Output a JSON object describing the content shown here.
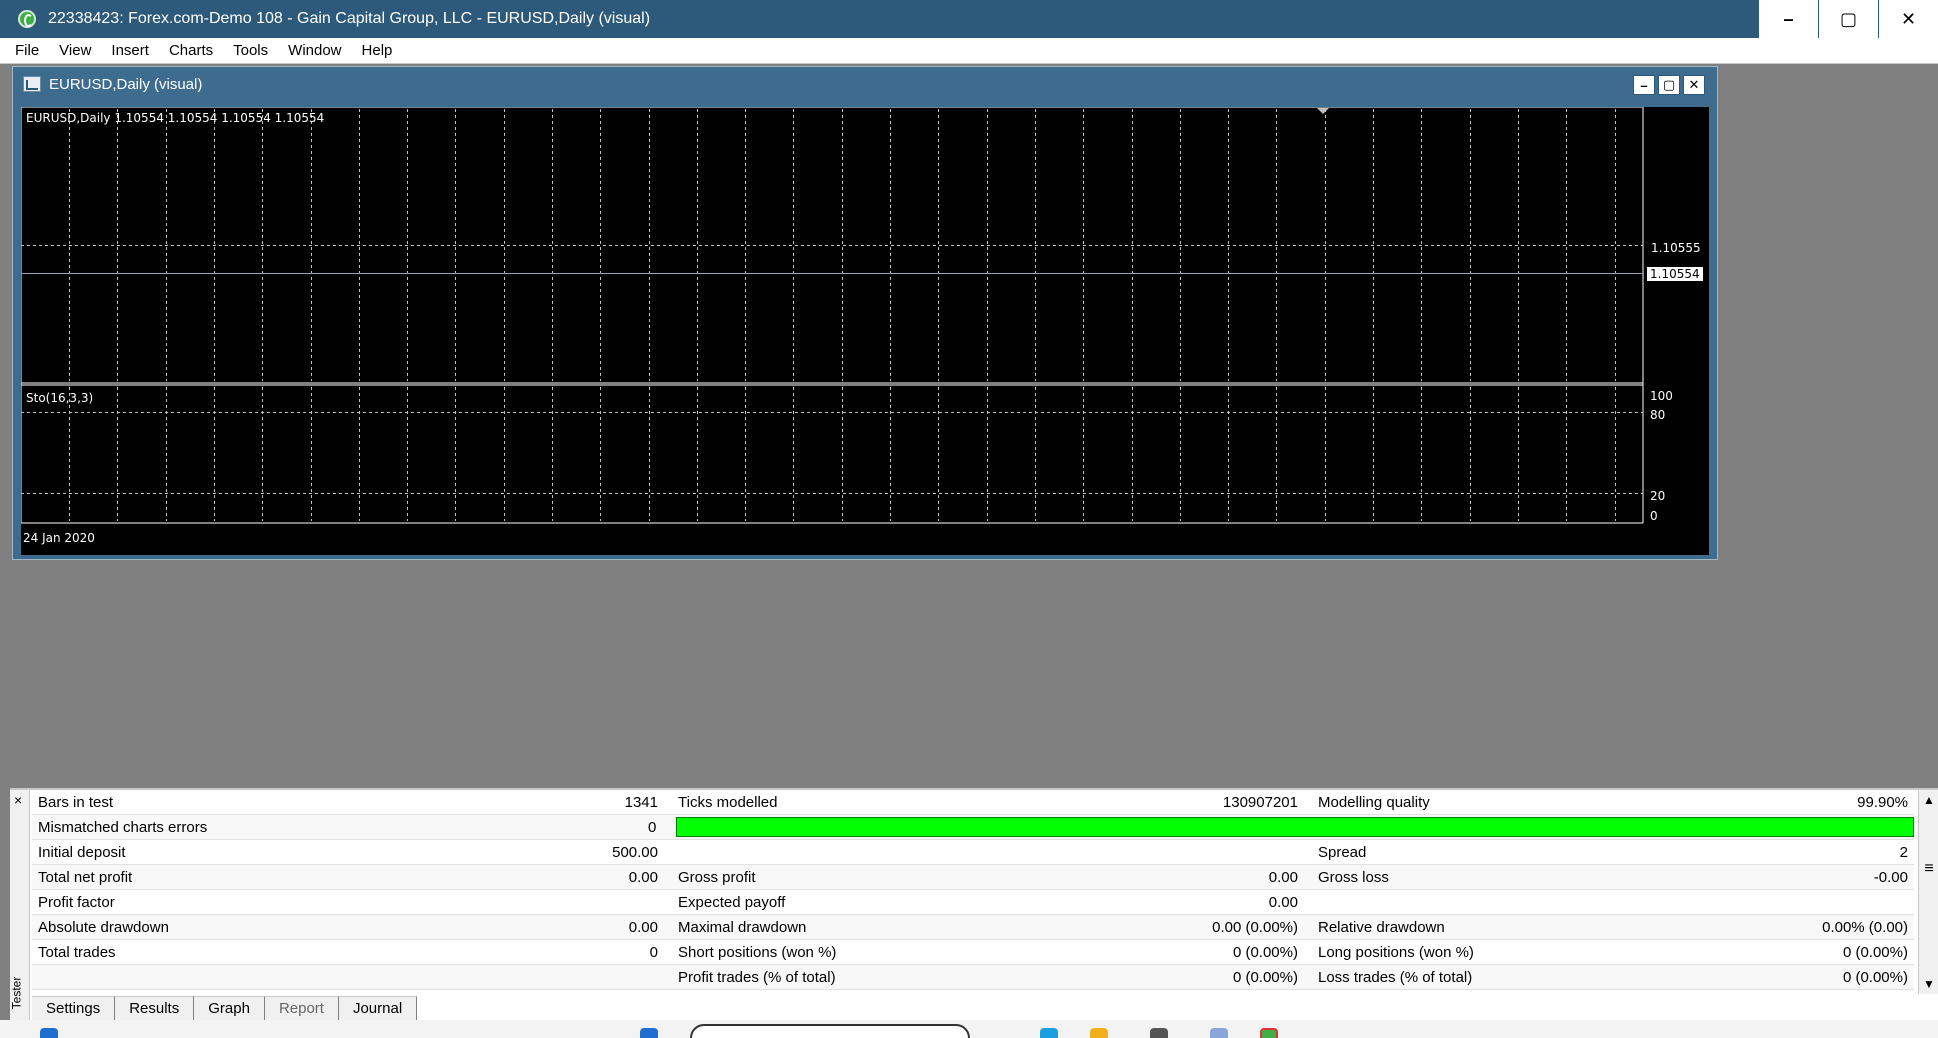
{
  "window": {
    "title": "22338423: Forex.com-Demo 108 - Gain Capital Group, LLC - EURUSD,Daily (visual)",
    "minimize": "–",
    "maximize": "▢",
    "close": "✕"
  },
  "menu": [
    "File",
    "View",
    "Insert",
    "Charts",
    "Tools",
    "Window",
    "Help"
  ],
  "chart": {
    "window_title": "EURUSD,Daily (visual)",
    "header": "EURUSD,Daily  1.10554 1.10554 1.10554 1.10554",
    "price_high": "1.10555",
    "price_current": "1.10554",
    "indicator_label": "Sto(16,3,3)",
    "sto_levels": [
      "100",
      "80",
      "20",
      "0"
    ],
    "date_label": "24 Jan 2020"
  },
  "tester": {
    "side_label": "Tester",
    "close": "×",
    "modelling_quality_fraction": 0.999,
    "rows": [
      {
        "l1": "Bars in test",
        "v1": "1341",
        "l2": "Ticks modelled",
        "v2": "130907201",
        "l3": "Modelling quality",
        "v3": "99.90%"
      },
      {
        "l1": "Mismatched charts errors",
        "v1": "0",
        "l2": "",
        "v2": "",
        "l3": "",
        "v3": ""
      },
      {
        "l1": "Initial deposit",
        "v1": "500.00",
        "l2": "",
        "v2": "",
        "l3": "Spread",
        "v3": "2"
      },
      {
        "l1": "Total net profit",
        "v1": "0.00",
        "l2": "Gross profit",
        "v2": "0.00",
        "l3": "Gross loss",
        "v3": "-0.00"
      },
      {
        "l1": "Profit factor",
        "v1": "",
        "l2": "Expected payoff",
        "v2": "0.00",
        "l3": "",
        "v3": ""
      },
      {
        "l1": "Absolute drawdown",
        "v1": "0.00",
        "l2": "Maximal drawdown",
        "v2": "0.00 (0.00%)",
        "l3": "Relative drawdown",
        "v3": "0.00% (0.00)"
      },
      {
        "l1": "Total trades",
        "v1": "0",
        "l2": "Short positions (won %)",
        "v2": "0 (0.00%)",
        "l3": "Long positions (won %)",
        "v3": "0 (0.00%)"
      },
      {
        "l1": "",
        "v1": "",
        "l2": "Profit trades (% of total)",
        "v2": "0 (0.00%)",
        "l3": "Loss trades (% of total)",
        "v3": "0 (0.00%)"
      }
    ],
    "tabs": [
      "Settings",
      "Results",
      "Graph",
      "Report",
      "Journal"
    ],
    "active_tab": "Report"
  }
}
